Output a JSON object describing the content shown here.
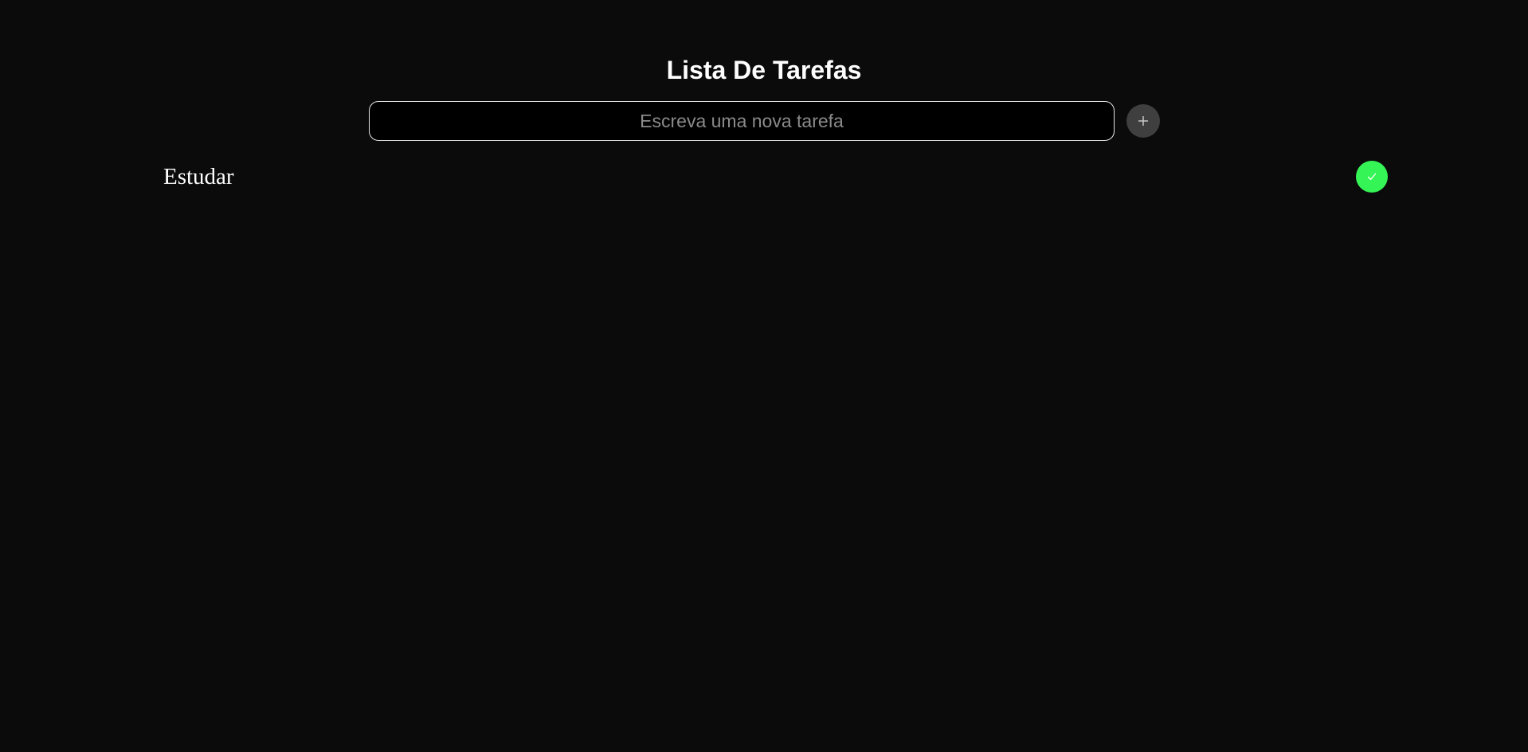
{
  "header": {
    "title": "Lista De Tarefas"
  },
  "new_task": {
    "placeholder": "Escreva uma nova tarefa",
    "value": "",
    "add_icon": "plus-icon"
  },
  "tasks": [
    {
      "label": "Estudar",
      "action_icon": "check-icon"
    }
  ],
  "colors": {
    "background": "#0b0b0b",
    "done_button": "#35f556",
    "add_button": "#3f3f3f"
  }
}
